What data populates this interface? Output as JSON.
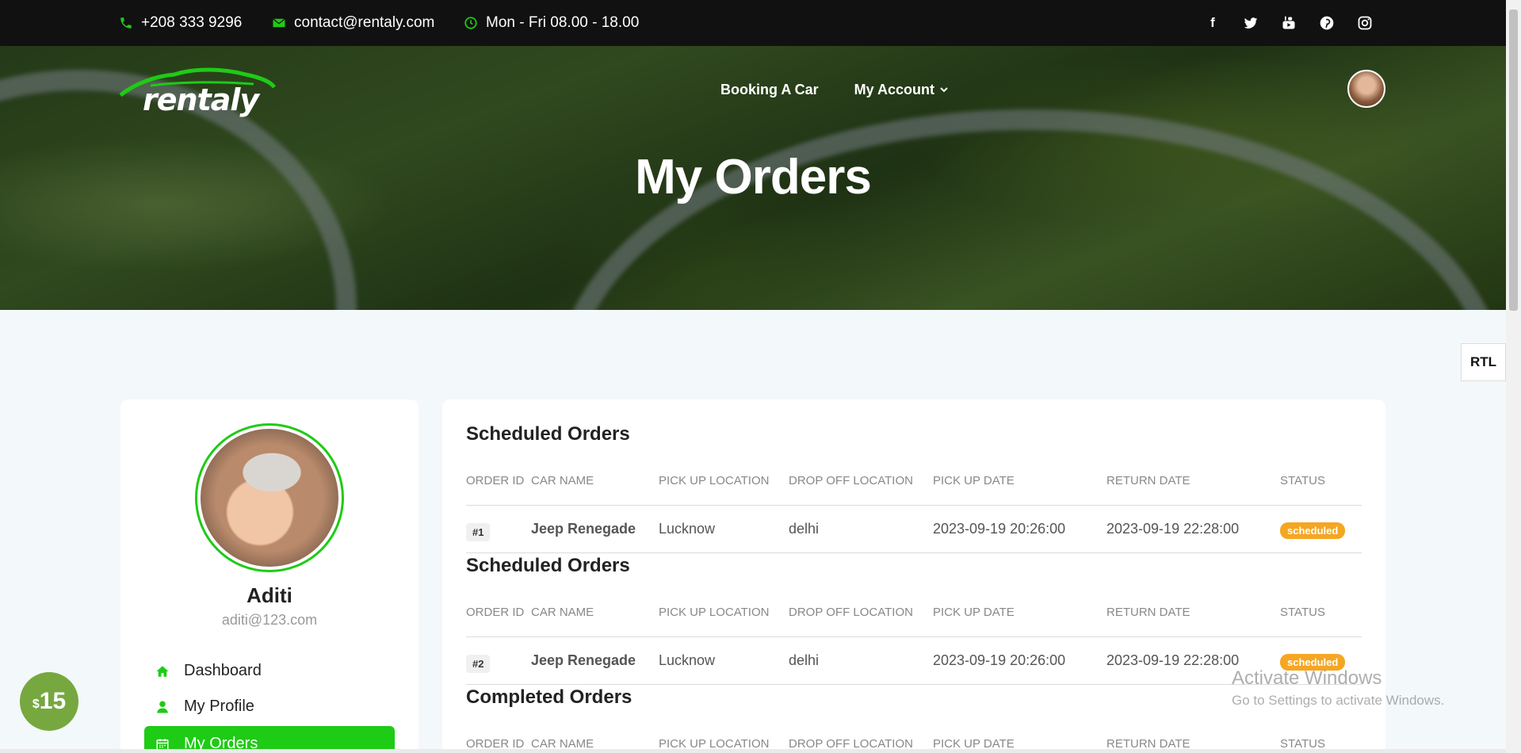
{
  "topbar": {
    "phone": "+208 333 9296",
    "email": "contact@rentaly.com",
    "hours": "Mon - Fri 08.00 - 18.00",
    "social_icons": [
      "facebook-icon",
      "twitter-icon",
      "youtube-icon",
      "pinterest-icon",
      "instagram-icon"
    ]
  },
  "brand": {
    "name": "rentaly",
    "accent": "#1ecb15"
  },
  "nav": {
    "booking": "Booking A Car",
    "account": "My Account"
  },
  "page": {
    "title": "My Orders"
  },
  "rtl_label": "RTL",
  "user": {
    "name": "Aditi",
    "email": "aditi@123.com"
  },
  "menu": {
    "dashboard": "Dashboard",
    "profile": "My Profile",
    "orders": "My Orders"
  },
  "columns": {
    "order_id": "ORDER ID",
    "car_name": "CAR NAME",
    "pickup_location": "PICK UP LOCATION",
    "dropoff_location": "DROP OFF LOCATION",
    "pickup_date": "PICK UP DATE",
    "return_date": "RETURN DATE",
    "status": "STATUS"
  },
  "sections": [
    {
      "title": "Scheduled Orders",
      "order": {
        "id": "#1",
        "car": "Jeep Renegade",
        "pickup": "Lucknow",
        "dropoff": "delhi",
        "pickup_date": "2023-09-19 20:26:00",
        "return_date": "2023-09-19 22:28:00",
        "status": "scheduled"
      }
    },
    {
      "title": "Scheduled Orders",
      "order": {
        "id": "#2",
        "car": "Jeep Renegade",
        "pickup": "Lucknow",
        "dropoff": "delhi",
        "pickup_date": "2023-09-19 20:26:00",
        "return_date": "2023-09-19 22:28:00",
        "status": "scheduled"
      }
    },
    {
      "title": "Completed Orders"
    }
  ],
  "price_badge": {
    "currency": "$",
    "amount": "15"
  },
  "watermark": {
    "line1": "Activate Windows",
    "line2": "Go to Settings to activate Windows."
  }
}
